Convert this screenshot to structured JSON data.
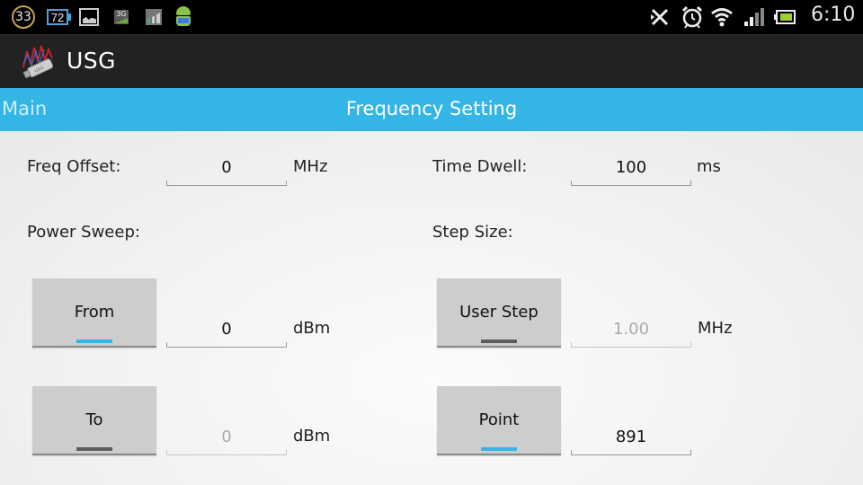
{
  "status_bar": {
    "notifications": [
      {
        "icon": "badge-count-icon",
        "text": "33"
      },
      {
        "icon": "battery-level-icon",
        "text": "72"
      },
      {
        "icon": "gallery-icon"
      },
      {
        "icon": "3g-data-icon",
        "text": "3G"
      },
      {
        "icon": "stats-chart-icon"
      },
      {
        "icon": "android-icon"
      }
    ],
    "system_icons": [
      "bluetooth-off-icon",
      "alarm-icon",
      "wifi-icon",
      "signal-icon",
      "battery-icon"
    ],
    "time": "6:10"
  },
  "action_bar": {
    "app_icon": "usg-app-icon",
    "title": "USG"
  },
  "tabs": {
    "previous": "Main",
    "current": "Frequency Setting",
    "accent_color": "#33b5e5"
  },
  "form": {
    "freq_offset": {
      "label": "Freq Offset:",
      "value": "0",
      "unit": "MHz"
    },
    "time_dwell": {
      "label": "Time Dwell:",
      "value": "100",
      "unit": "ms"
    },
    "power_sweep": {
      "label": "Power Sweep:",
      "from": {
        "button": "From",
        "active": true,
        "value": "0",
        "unit": "dBm",
        "enabled": true
      },
      "to": {
        "button": "To",
        "active": false,
        "value": "0",
        "unit": "dBm",
        "enabled": false
      }
    },
    "step_size": {
      "label": "Step Size:",
      "user_step": {
        "button": "User Step",
        "active": false,
        "value": "1.00",
        "unit": "MHz",
        "enabled": false
      },
      "point": {
        "button": "Point",
        "active": true,
        "value": "891",
        "enabled": true
      }
    }
  }
}
